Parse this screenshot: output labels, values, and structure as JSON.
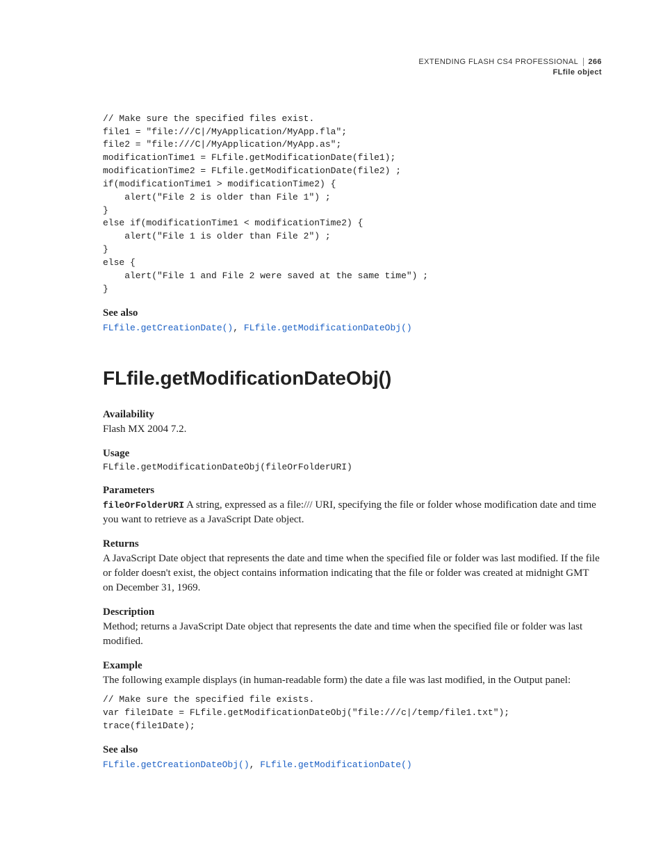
{
  "header": {
    "title": "EXTENDING FLASH CS4 PROFESSIONAL",
    "page_number": "266",
    "section": "FLfile object"
  },
  "code_block_1": "// Make sure the specified files exist.\nfile1 = \"file:///C|/MyApplication/MyApp.fla\";\nfile2 = \"file:///C|/MyApplication/MyApp.as\";\nmodificationTime1 = FLfile.getModificationDate(file1);\nmodificationTime2 = FLfile.getModificationDate(file2) ;\nif(modificationTime1 > modificationTime2) {\n    alert(\"File 2 is older than File 1\") ;\n}\nelse if(modificationTime1 < modificationTime2) {\n    alert(\"File 1 is older than File 2\") ;\n}\nelse {\n    alert(\"File 1 and File 2 were saved at the same time\") ;\n}",
  "see_also_1": {
    "label": "See also",
    "links": [
      "FLfile.getCreationDate()",
      "FLfile.getModificationDateObj()"
    ],
    "sep": ", "
  },
  "api_heading": "FLfile.getModificationDateObj()",
  "availability": {
    "label": "Availability",
    "text": "Flash MX 2004 7.2."
  },
  "usage": {
    "label": "Usage",
    "code": "FLfile.getModificationDateObj(fileOrFolderURI)"
  },
  "parameters": {
    "label": "Parameters",
    "param_name": "fileOrFolderURI",
    "text": "  A string, expressed as a file:/// URI, specifying the file or folder whose modification date and time you want to retrieve as a JavaScript Date object."
  },
  "returns": {
    "label": "Returns",
    "text": "A JavaScript Date object that represents the date and time when the specified file or folder was last modified. If the file or folder doesn't exist, the object contains information indicating that the file or folder was created at midnight GMT on December 31, 1969."
  },
  "description": {
    "label": "Description",
    "text": "Method; returns a JavaScript Date object that represents the date and time when the specified file or folder was last modified."
  },
  "example": {
    "label": "Example",
    "intro": "The following example displays (in human-readable form) the date a file was last modified, in the Output panel:",
    "code": "// Make sure the specified file exists.\nvar file1Date = FLfile.getModificationDateObj(\"file:///c|/temp/file1.txt\");\ntrace(file1Date);"
  },
  "see_also_2": {
    "label": "See also",
    "links": [
      "FLfile.getCreationDateObj()",
      "FLfile.getModificationDate()"
    ],
    "sep": ", "
  }
}
